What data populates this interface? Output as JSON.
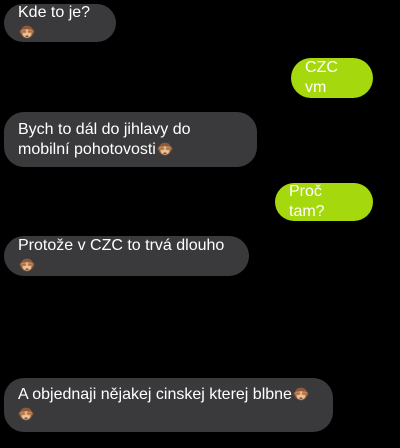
{
  "chat": {
    "messages": [
      {
        "direction": "incoming",
        "text": "Kde to je?",
        "emoji": "see-no-evil-monkey"
      },
      {
        "direction": "outgoing",
        "text": "CZC vm"
      },
      {
        "direction": "incoming",
        "text": "Bych to dál do jihlavy do mobilní pohotovosti",
        "emoji": "see-no-evil-monkey"
      },
      {
        "direction": "outgoing",
        "text": "Proč tam?"
      },
      {
        "direction": "incoming",
        "text": "Protože v CZC to trvá dlouho",
        "emoji": "see-no-evil-monkey"
      },
      {
        "direction": "incoming",
        "text": "A objednaji nějakej cinskej kterej blbne",
        "emoji": "see-no-evil-monkey",
        "trailing_emoji": "see-no-evil-monkey"
      }
    ]
  },
  "colors": {
    "background": "#000000",
    "incoming_bubble": "#3a3a3c",
    "outgoing_bubble": "#a6d80e",
    "text": "#ffffff"
  }
}
